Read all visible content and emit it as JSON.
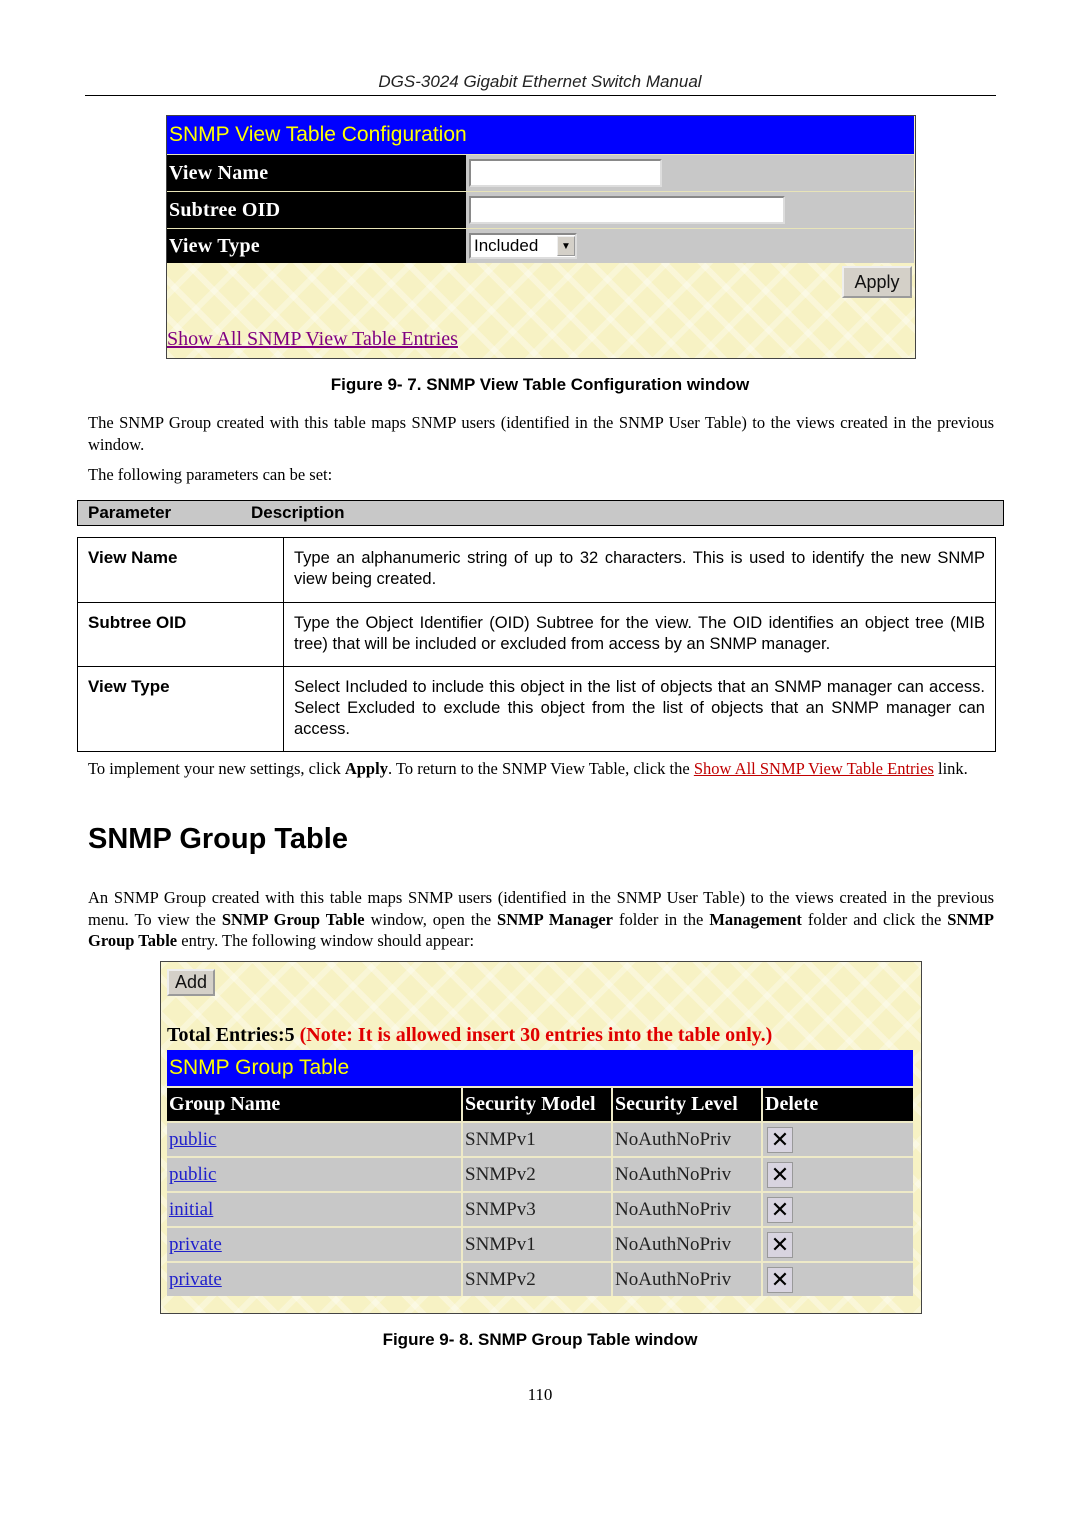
{
  "header": {
    "title": "DGS-3024 Gigabit Ethernet Switch Manual"
  },
  "figure1": {
    "title": "SNMP View Table Configuration",
    "fields": [
      {
        "label": "View Name",
        "value": ""
      },
      {
        "label": "Subtree OID",
        "value": ""
      },
      {
        "label": "View Type",
        "value": "Included"
      }
    ],
    "apply_label": "Apply",
    "show_all_link": "Show All SNMP View Table Entries",
    "caption": "Figure 9- 7. SNMP View Table Configuration window"
  },
  "intro": {
    "p1": "The SNMP Group created with this table maps SNMP users (identified in the SNMP User Table) to the views created in the previous window.",
    "p2": "The following parameters can be set:"
  },
  "params": {
    "headers": [
      "Parameter",
      "Description"
    ],
    "rows": [
      {
        "name": "View Name",
        "desc": "Type an alphanumeric string of up to 32 characters. This is used to identify the new SNMP view being created."
      },
      {
        "name": "Subtree OID",
        "desc": "Type the Object Identifier (OID) Subtree for the view. The OID identifies an object tree (MIB tree) that will be included or excluded from access by an SNMP manager."
      },
      {
        "name": "View Type",
        "desc": "Select Included to include this object in the list of objects that an SNMP manager can access. Select Excluded to exclude this object from the list of objects that an SNMP manager can access."
      }
    ]
  },
  "implement": {
    "t1": "To implement your new settings, click ",
    "b1": "Apply",
    "t2": ". To return to the SNMP View Table, click the ",
    "link": "Show All SNMP View Table Entries",
    "t3": " link."
  },
  "section": {
    "heading": "SNMP Group Table",
    "p": {
      "t1": "An SNMP Group created with this table maps SNMP users (identified in the SNMP User Table) to the views created in the previous menu. To view the ",
      "b1": "SNMP Group Table",
      "t2": " window, open the ",
      "b2": "SNMP Manager",
      "t3": " folder in the ",
      "b3": "Management",
      "t4": " folder and click the ",
      "b4": "SNMP Group Table",
      "t5": " entry. The following window should appear:"
    }
  },
  "figure2": {
    "add_label": "Add",
    "total": "Total Entries:5",
    "note": "(Note: It is allowed insert 30 entries into the table only.)",
    "title": "SNMP Group Table",
    "columns": [
      "Group Name",
      "Security Model",
      "Security Level",
      "Delete"
    ],
    "rows": [
      {
        "group": "public",
        "model": "SNMPv1",
        "level": "NoAuthNoPriv"
      },
      {
        "group": "public",
        "model": "SNMPv2",
        "level": "NoAuthNoPriv"
      },
      {
        "group": "initial",
        "model": "SNMPv3",
        "level": "NoAuthNoPriv"
      },
      {
        "group": "private",
        "model": "SNMPv1",
        "level": "NoAuthNoPriv"
      },
      {
        "group": "private",
        "model": "SNMPv2",
        "level": "NoAuthNoPriv"
      }
    ],
    "delete_glyph": "✕",
    "caption": "Figure 9- 8. SNMP Group Table window"
  },
  "page_number": "110",
  "colors": {
    "title_bar": "#0000ff",
    "title_text": "#ffff00",
    "link": "#c00000",
    "note": "#e00000"
  }
}
